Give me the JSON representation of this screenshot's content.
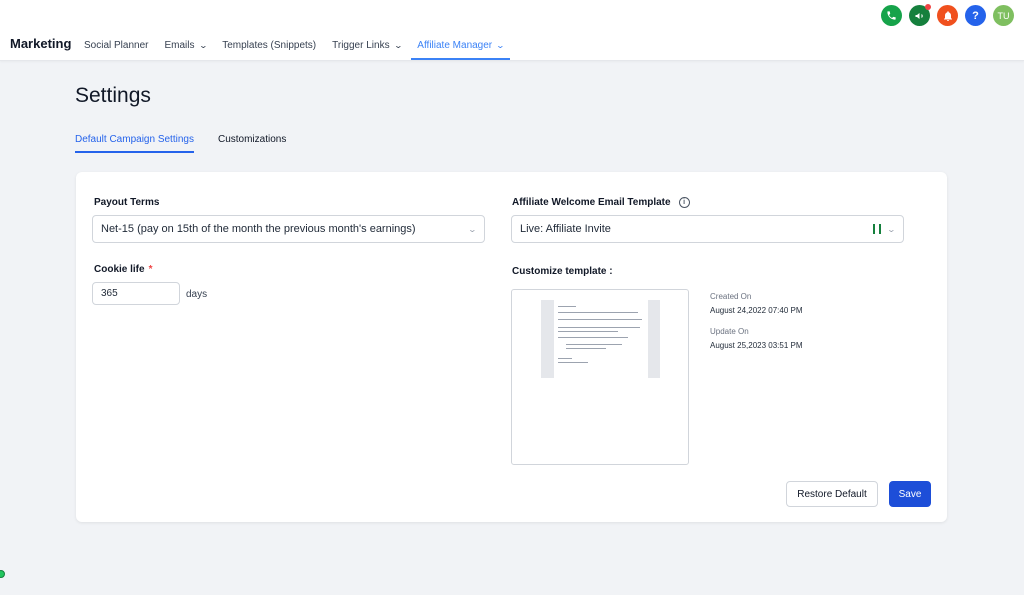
{
  "header": {
    "brand": "Marketing",
    "nav": [
      {
        "label": "Social Planner",
        "dropdown": false,
        "active": false
      },
      {
        "label": "Emails",
        "dropdown": true,
        "active": false
      },
      {
        "label": "Templates (Snippets)",
        "dropdown": false,
        "active": false
      },
      {
        "label": "Trigger Links",
        "dropdown": true,
        "active": false
      },
      {
        "label": "Affiliate Manager",
        "dropdown": true,
        "active": true
      }
    ],
    "icons": {
      "phone": "phone-icon",
      "announcements": "megaphone-icon",
      "notifications": "bell-icon",
      "help": "?",
      "avatar": "TU"
    }
  },
  "page": {
    "title": "Settings",
    "tabs": [
      {
        "label": "Default Campaign Settings",
        "active": true
      },
      {
        "label": "Customizations",
        "active": false
      }
    ]
  },
  "form": {
    "payout_terms": {
      "label": "Payout Terms",
      "value": "Net-15 (pay on 15th of the month the previous month's earnings)"
    },
    "cookie_life": {
      "label": "Cookie life",
      "required_mark": "*",
      "value": "365",
      "unit": "days"
    },
    "welcome_template": {
      "label": "Affiliate Welcome Email Template",
      "value": "Live:  Affiliate Invite"
    },
    "customize": {
      "label": "Customize template :",
      "created_label": "Created On",
      "created_value": "August 24,2022 07:40 PM",
      "updated_label": "Update On",
      "updated_value": "August 25,2023 03:51 PM"
    }
  },
  "actions": {
    "restore_label": "Restore Default",
    "save_label": "Save"
  },
  "colors": {
    "accent": "#2563eb",
    "primary_button": "#1d4ed8",
    "background": "#f1f3f6"
  }
}
